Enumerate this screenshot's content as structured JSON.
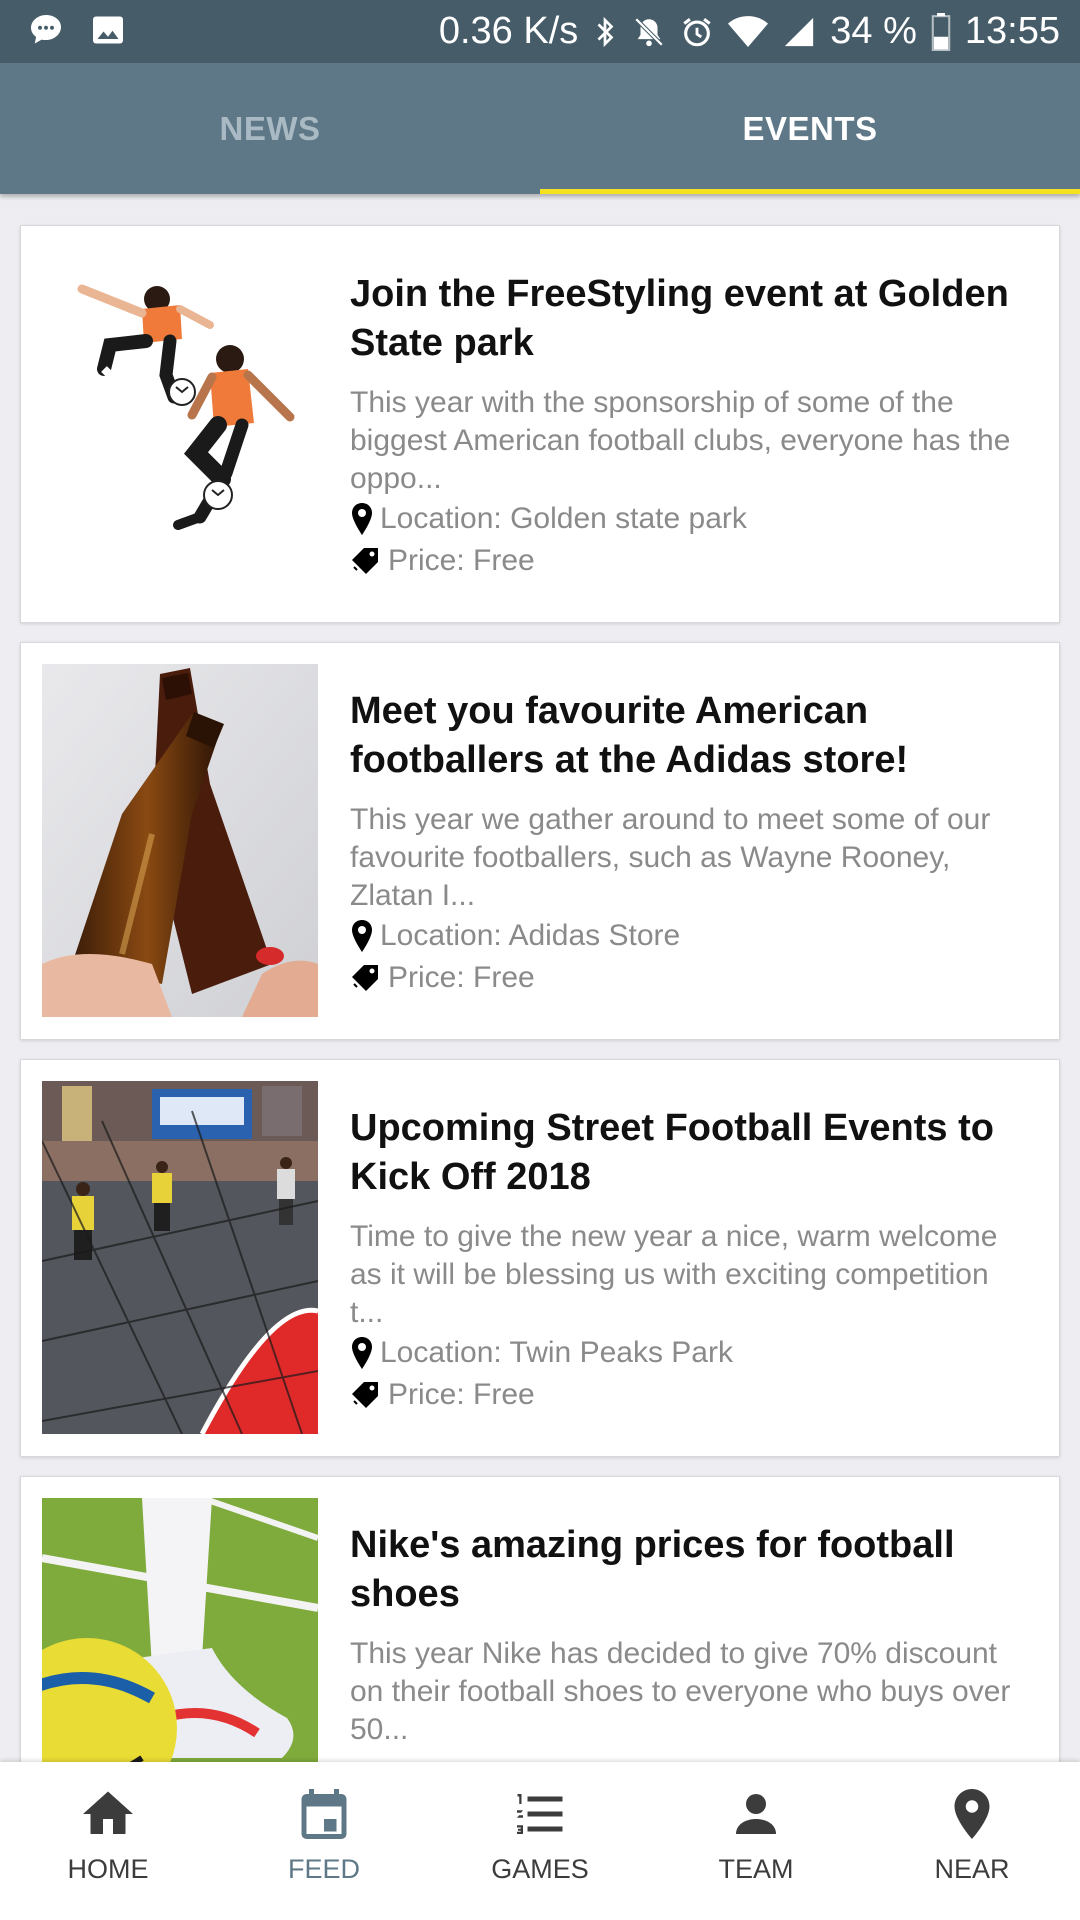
{
  "status_bar": {
    "net_speed": "0.36 K/s",
    "battery": "34 %",
    "time": "13:55",
    "left_icons": [
      "chat-bubble-icon",
      "image-icon"
    ],
    "right_icons": [
      "bluetooth-icon",
      "mute-icon",
      "alarm-icon",
      "wifi-icon",
      "signal-icon",
      "battery-icon"
    ]
  },
  "tabs": [
    {
      "label": "NEWS",
      "selected": false
    },
    {
      "label": "EVENTS",
      "selected": true
    }
  ],
  "colors": {
    "status_bar": "#465c69",
    "app_bar": "#5f7887",
    "tab_indicator": "#f4e120",
    "active_nav": "#5f7887"
  },
  "events": [
    {
      "title": "Join the FreeStyling event at Golden State park",
      "description": "This year with the sponsorship of some of the biggest American football clubs, everyone has the oppo...",
      "location": "Location: Golden state park",
      "price": "Price: Free",
      "image": "freestyle-players-image"
    },
    {
      "title": "Meet you favourite American footballers at the Adidas store!",
      "description": "This year we gather around to meet some of our favourite footballers, such as Wayne Rooney, Zlatan I...",
      "location": "Location: Adidas Store",
      "price": "Price: Free",
      "image": "beer-bottles-image"
    },
    {
      "title": "Upcoming Street Football Events to Kick Off 2018",
      "description": "Time to give the new year a nice, warm welcome as it will be blessing us with exciting competition t...",
      "location": "Location: Twin Peaks Park",
      "price": "Price: Free",
      "image": "street-football-image"
    },
    {
      "title": "Nike's amazing prices for football shoes",
      "description": "This year Nike has decided to give 70% discount on their football shoes to everyone who buys over 50...",
      "image": "football-shoe-image"
    }
  ],
  "bottom_nav": [
    {
      "label": "HOME",
      "icon": "home-icon"
    },
    {
      "label": "FEED",
      "icon": "calendar-icon",
      "active": true
    },
    {
      "label": "GAMES",
      "icon": "list-icon"
    },
    {
      "label": "TEAM",
      "icon": "person-icon"
    },
    {
      "label": "NEAR",
      "icon": "location-pin-icon"
    }
  ]
}
